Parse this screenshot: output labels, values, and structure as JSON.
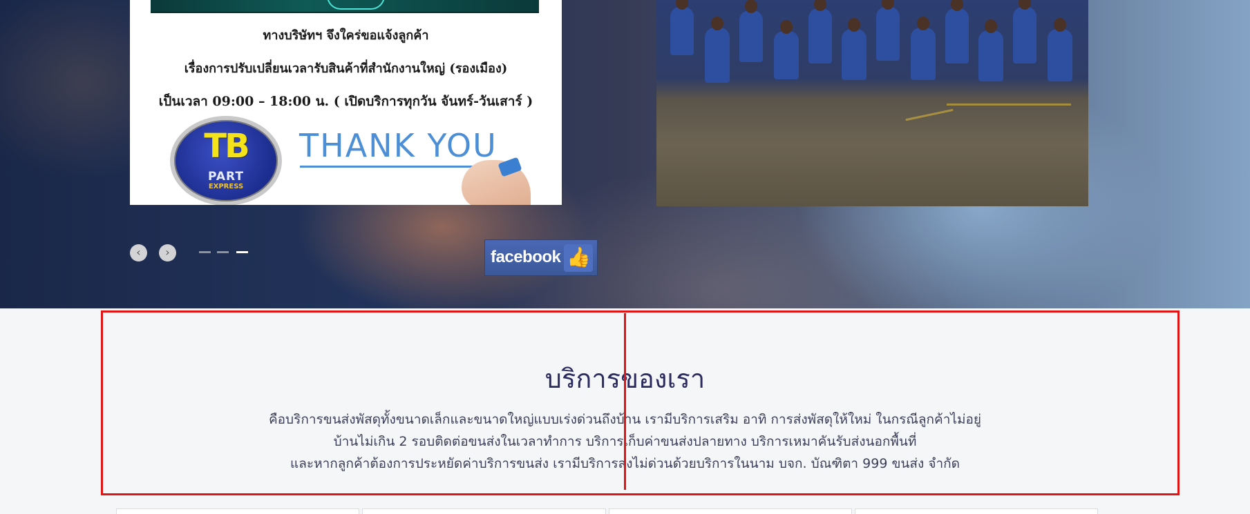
{
  "notice": {
    "line1": "ทางบริษัทฯ จึงใคร่ขอแจ้งลูกค้า",
    "line2": "เรื่องการปรับเปลี่ยนเวลารับสินค้าที่สำนักงานใหญ่ (รองเมือง)",
    "line3": "เป็นเวลา  09:00 – 18:00 น. ( เปิดบริการทุกวัน จันทร์-วันเสาร์ )",
    "logo_mark": "TB",
    "logo_part": "PART",
    "logo_express": "EXPRESS",
    "thank_you": "THANK YOU"
  },
  "slider": {
    "prev_icon": "chevron-left-icon",
    "next_icon": "chevron-right-icon",
    "prev_glyph": "‹",
    "next_glyph": "›",
    "dots": 3,
    "active_dot": 3
  },
  "facebook": {
    "label": "facebook",
    "icon": "thumbs-up-icon"
  },
  "services": {
    "title": "บริการของเรา",
    "lines": [
      "คือบริการขนส่งพัสดุทั้งขนาดเล็กและขนาดใหญ่แบบเร่งด่วนถึงบ้าน เรามีบริการเสริม อาทิ การส่งพัสดุให้ใหม่ ในกรณีลูกค้าไม่อยู่",
      "บ้านไม่เกิน 2 รอบติดต่อขนส่งในเวลาทำการ บริการเก็บค่าขนส่งปลายทาง บริการเหมาคันรับส่งนอกพื้นที่",
      "และหากลูกค้าต้องการประหยัดค่าบริการขนส่ง เรามีบริการส่งไม่ด่วนด้วยบริการในนาม บจก. บัณฑิตา 999 ขนส่ง จำกัด"
    ]
  },
  "colors": {
    "highlight": "#e01414",
    "title": "#2a2a5e",
    "facebook": "#3b5998",
    "accent_blue": "#4d8fd6"
  }
}
